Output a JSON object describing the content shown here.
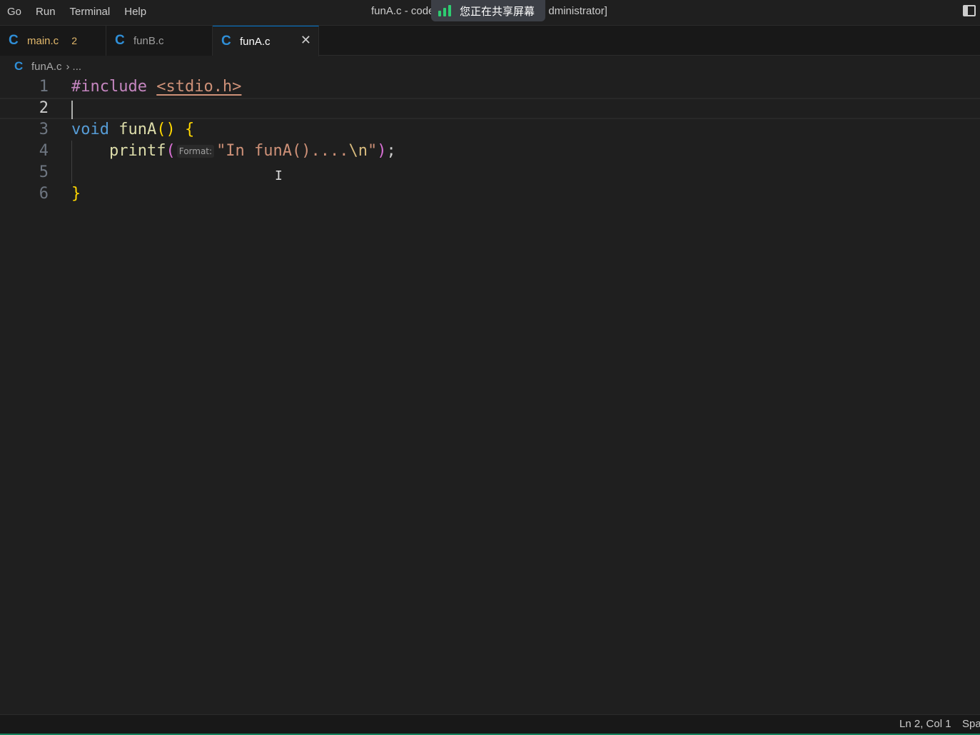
{
  "menu": [
    "Go",
    "Run",
    "Terminal",
    "Help"
  ],
  "window": {
    "title_left": "funA.c - code",
    "title_right": "dministrator]"
  },
  "share_overlay": {
    "text": "您正在共享屏幕",
    "icon": "signal-bars-icon",
    "color": "#2ecc71"
  },
  "tabs": [
    {
      "label": "main.c",
      "badge": "2",
      "icon": "c-language-icon"
    },
    {
      "label": "funB.c",
      "icon": "c-language-icon"
    },
    {
      "label": "funA.c",
      "icon": "c-language-icon",
      "active": true
    }
  ],
  "breadcrumb": {
    "file": "funA.c",
    "more": "..."
  },
  "editor": {
    "line_numbers": [
      "1",
      "2",
      "3",
      "4",
      "5",
      "6"
    ],
    "active_line": "2",
    "code": {
      "l1_directive": "#include",
      "l1_header": "<stdio.h>",
      "l3_keyword": "void",
      "l3_name": "funA",
      "l3_parens": "()",
      "l3_open_brace": "{",
      "l4_call": "printf",
      "l4_open_paren": "(",
      "l4_inlay_hint": "Format:",
      "l4_string_start": "\"In funA()....",
      "l4_escape": "\\n",
      "l4_string_end": "\"",
      "l4_close_paren": ")",
      "l4_semicolon": ";",
      "l6_close_brace": "}"
    }
  },
  "status": {
    "position": "Ln 2, Col 1",
    "spaces": "Spa"
  },
  "colors": {
    "accent": "#0078d4",
    "keyword": "#569cd6",
    "function": "#dcdcaa",
    "string": "#ce9178",
    "preprocessor": "#c586c0",
    "bracket": "#ffd700"
  }
}
